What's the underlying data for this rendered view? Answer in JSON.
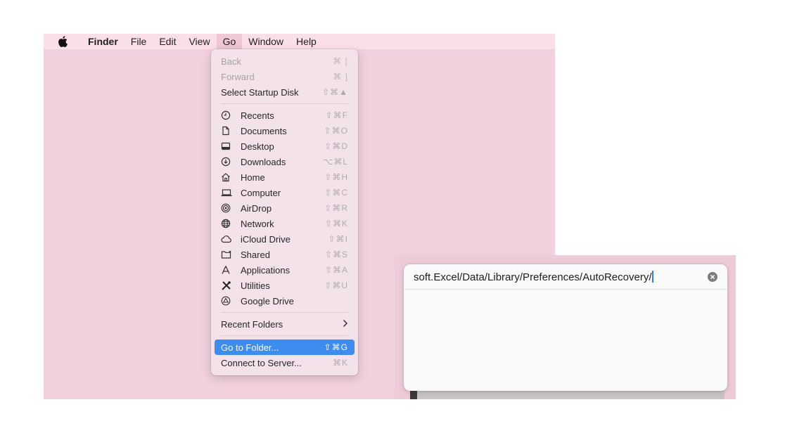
{
  "menubar": {
    "apple_icon": "apple-logo-icon",
    "items": [
      {
        "label": "Finder",
        "bold": true
      },
      {
        "label": "File"
      },
      {
        "label": "Edit"
      },
      {
        "label": "View"
      },
      {
        "label": "Go",
        "active": true
      },
      {
        "label": "Window"
      },
      {
        "label": "Help"
      }
    ]
  },
  "go_menu": {
    "top_items": [
      {
        "label": "Back",
        "shortcut": "⌘ [",
        "disabled": true
      },
      {
        "label": "Forward",
        "shortcut": "⌘ ]",
        "disabled": true
      },
      {
        "label": "Select Startup Disk",
        "shortcut": "⇧⌘▲"
      }
    ],
    "places": [
      {
        "label": "Recents",
        "shortcut": "⇧⌘F",
        "icon": "clock-icon"
      },
      {
        "label": "Documents",
        "shortcut": "⇧⌘O",
        "icon": "document-icon"
      },
      {
        "label": "Desktop",
        "shortcut": "⇧⌘D",
        "icon": "desktop-icon"
      },
      {
        "label": "Downloads",
        "shortcut": "⌥⌘L",
        "icon": "download-icon"
      },
      {
        "label": "Home",
        "shortcut": "⇧⌘H",
        "icon": "home-icon"
      },
      {
        "label": "Computer",
        "shortcut": "⇧⌘C",
        "icon": "laptop-icon"
      },
      {
        "label": "AirDrop",
        "shortcut": "⇧⌘R",
        "icon": "airdrop-icon"
      },
      {
        "label": "Network",
        "shortcut": "⇧⌘K",
        "icon": "globe-icon"
      },
      {
        "label": "iCloud Drive",
        "shortcut": "⇧⌘I",
        "icon": "cloud-icon"
      },
      {
        "label": "Shared",
        "shortcut": "⇧⌘S",
        "icon": "shared-folder-icon"
      },
      {
        "label": "Applications",
        "shortcut": "⇧⌘A",
        "icon": "applications-icon"
      },
      {
        "label": "Utilities",
        "shortcut": "⇧⌘U",
        "icon": "tools-icon"
      },
      {
        "label": "Google Drive",
        "shortcut": "",
        "icon": "google-drive-icon"
      }
    ],
    "recent_folders": {
      "label": "Recent Folders",
      "icon": "chevron-right-icon"
    },
    "bottom_items": [
      {
        "label": "Go to Folder...",
        "shortcut": "⇧⌘G",
        "highlighted": true
      },
      {
        "label": "Connect to Server...",
        "shortcut": "⌘K"
      }
    ]
  },
  "go_to_folder": {
    "path_value": "soft.Excel/Data/Library/Preferences/AutoRecovery/",
    "clear_icon": "clear-circle-icon"
  },
  "colors": {
    "desktop_pink": "#f2d1de",
    "menubar_pink": "#fbdfe8",
    "highlight_blue": "#3f8cf0"
  }
}
